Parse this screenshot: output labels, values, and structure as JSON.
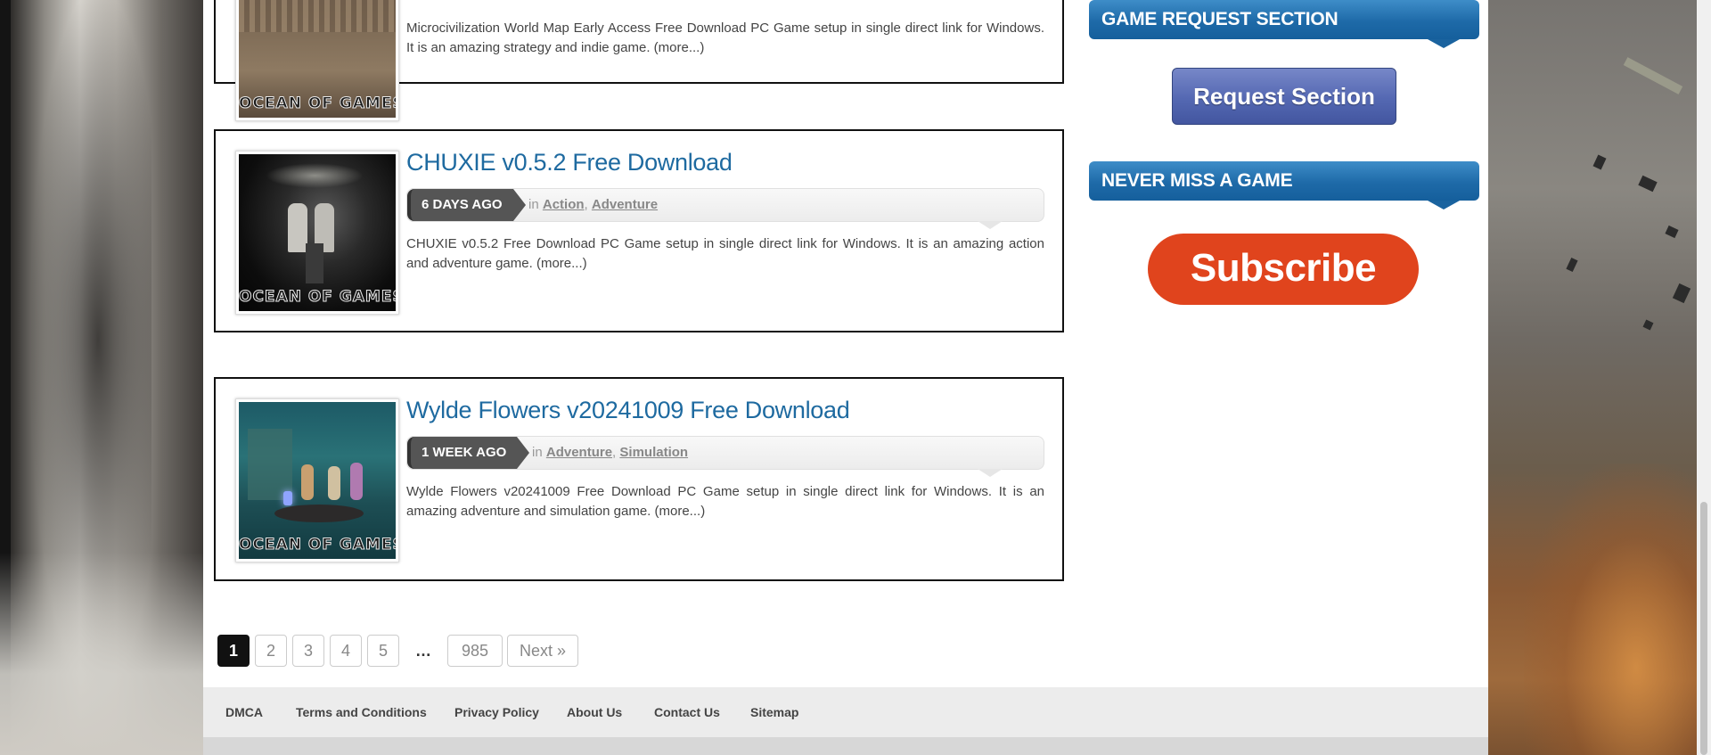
{
  "posts": [
    {
      "title": "",
      "date": "",
      "categories_prefix": "",
      "categories": [],
      "excerpt": "Microcivilization World Map Early Access Free Download PC Game setup in single direct link for Windows. It is an amazing strategy and indie game.",
      "more": "(more...)",
      "watermark": "OCEAN OF GAMES"
    },
    {
      "title": "CHUXIE v0.5.2 Free Download",
      "date": "6 DAYS AGO",
      "categories_prefix": "in",
      "categories": [
        "Action",
        "Adventure"
      ],
      "excerpt": "CHUXIE v0.5.2 Free Download PC Game setup in single direct link for Windows. It is an amazing action and adventure game.",
      "more": "(more...)",
      "watermark": "OCEAN OF GAMES"
    },
    {
      "title": "Wylde Flowers v20241009 Free Download",
      "date": "1 WEEK AGO",
      "categories_prefix": "in",
      "categories": [
        "Adventure",
        "Simulation"
      ],
      "excerpt": "Wylde Flowers v20241009 Free Download PC Game setup in single direct link for Windows. It is an amazing adventure and simulation game.",
      "more": "(more...)",
      "watermark": "OCEAN OF GAMES"
    }
  ],
  "pagination": {
    "pages": [
      "1",
      "2",
      "3",
      "4",
      "5"
    ],
    "current": "1",
    "ellipsis": "…",
    "last": "985",
    "next": "Next »"
  },
  "footer": {
    "links": [
      "DMCA",
      "Terms and Conditions",
      "Privacy Policy",
      "About Us",
      "Contact Us",
      "Sitemap"
    ]
  },
  "sidebar": {
    "request_title": "GAME REQUEST SECTION",
    "request_button": "Request Section",
    "subscribe_title": "NEVER MISS A GAME",
    "subscribe_button": "Subscribe"
  },
  "colors": {
    "title_link": "#1e6aa0",
    "widget_blue": "#1e6aa8",
    "subscribe_red": "#e0441d",
    "request_purple": "#5468b2"
  }
}
